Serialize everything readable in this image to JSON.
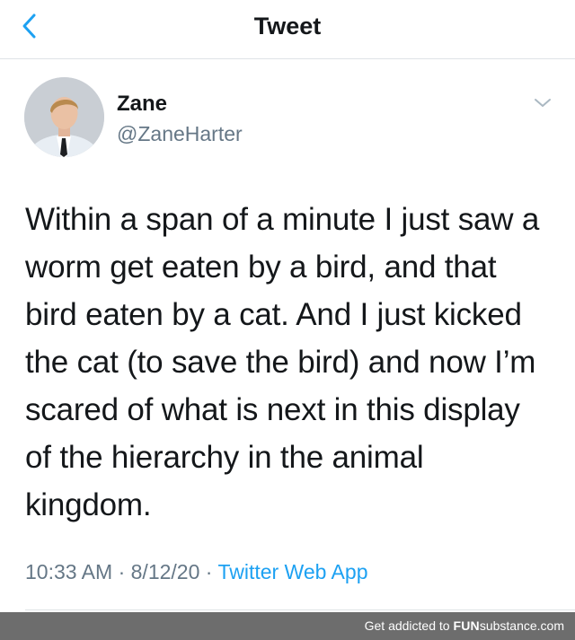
{
  "header": {
    "title": "Tweet",
    "back_icon": "chevron-left-icon"
  },
  "tweet": {
    "author": {
      "name": "Zane",
      "handle": "@ZaneHarter"
    },
    "text": "Within a span of a minute I just saw a\nworm get eaten by a bird, and that\nbird eaten by a cat. And I just kicked\nthe cat (to save the bird) and now I’m\nscared of what is next in this display\nof the hierarchy in the animal\nkingdom.",
    "time": "10:33 AM",
    "date": "8/12/20",
    "separator": "·",
    "source": "Twitter Web App"
  },
  "watermark": {
    "prefix": "Get addicted to",
    "brand_bold": "FUN",
    "brand_rest": "substance.com"
  },
  "colors": {
    "accent": "#1da1f2",
    "secondary_text": "#657786",
    "primary_text": "#14171a",
    "watermark_bg": "#6d6d6d"
  }
}
